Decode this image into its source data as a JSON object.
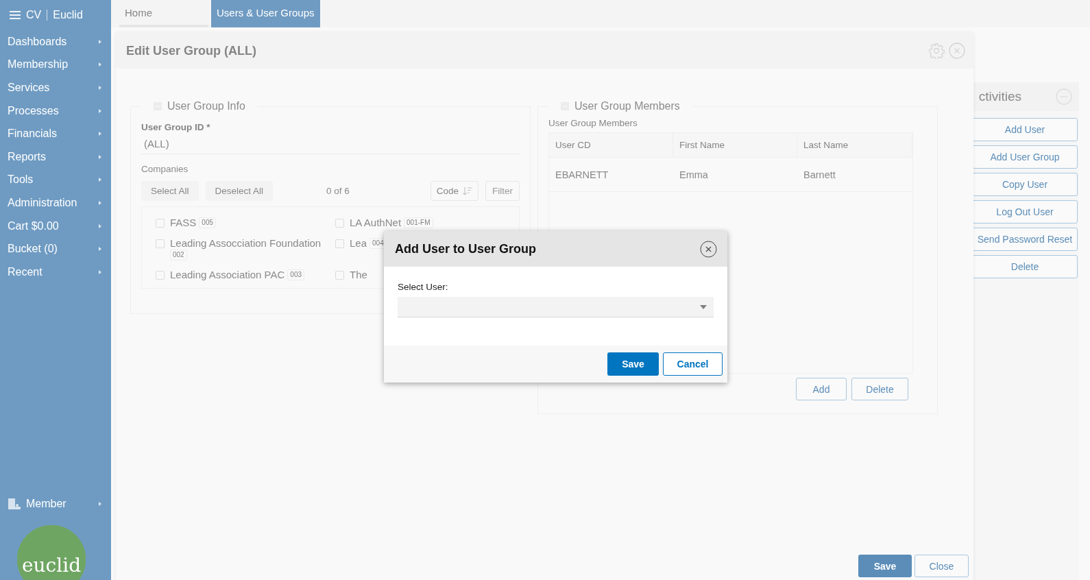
{
  "sidebar": {
    "brand": "CV",
    "product": "Euclid",
    "items": [
      {
        "label": "Dashboards"
      },
      {
        "label": "Membership"
      },
      {
        "label": "Services"
      },
      {
        "label": "Processes"
      },
      {
        "label": "Financials"
      },
      {
        "label": "Reports"
      },
      {
        "label": "Tools"
      },
      {
        "label": "Administration"
      },
      {
        "label": "Cart $0.00"
      },
      {
        "label": "Bucket (0)"
      },
      {
        "label": "Recent"
      }
    ],
    "footer_item": {
      "label": "Member"
    },
    "logo": "euclid"
  },
  "tabs": [
    {
      "label": "Home",
      "selected": false
    },
    {
      "label": "Users & User Groups",
      "selected": true
    }
  ],
  "activities": {
    "title": "ctivities",
    "buttons": [
      "Add User",
      "Add User Group",
      "Copy User",
      "Log Out User",
      "Send Password Reset",
      "Delete"
    ]
  },
  "edit_dialog": {
    "title": "Edit User Group (ALL)",
    "info": {
      "legend": "User Group Info",
      "id_label": "User Group ID *",
      "id_value": "(ALL)",
      "companies_label": "Companies",
      "select_all": "Select All",
      "deselect_all": "Deselect All",
      "count": "0 of 6",
      "sort": "Code",
      "filter": "Filter",
      "companies": [
        {
          "name": "FASS",
          "code": "005",
          "checked": false
        },
        {
          "name": "LA AuthNet",
          "code": "001-FM",
          "checked": false
        },
        {
          "name": "Leading Assocciation Foundation",
          "code": "002",
          "checked": false
        },
        {
          "name": "Lea",
          "code": "004",
          "checked": false
        },
        {
          "name": "Leading Association PAC",
          "code": "003",
          "checked": false
        },
        {
          "name": "The",
          "checked": false
        }
      ]
    },
    "members": {
      "legend": "User Group Members",
      "table_label": "User Group Members",
      "columns": [
        "User CD",
        "First Name",
        "Last Name"
      ],
      "rows": [
        [
          "EBARNETT",
          "Emma",
          "Barnett"
        ]
      ],
      "buttons": [
        "Add",
        "Delete"
      ]
    },
    "footer_buttons": [
      {
        "label": "Save",
        "kind": "primary"
      },
      {
        "label": "Close",
        "kind": "secondary"
      }
    ]
  },
  "modal": {
    "title": "Add User to User Group",
    "field_label": "Select User:",
    "buttons": [
      {
        "label": "Save",
        "kind": "primary"
      },
      {
        "label": "Cancel",
        "kind": "secondary"
      }
    ]
  }
}
